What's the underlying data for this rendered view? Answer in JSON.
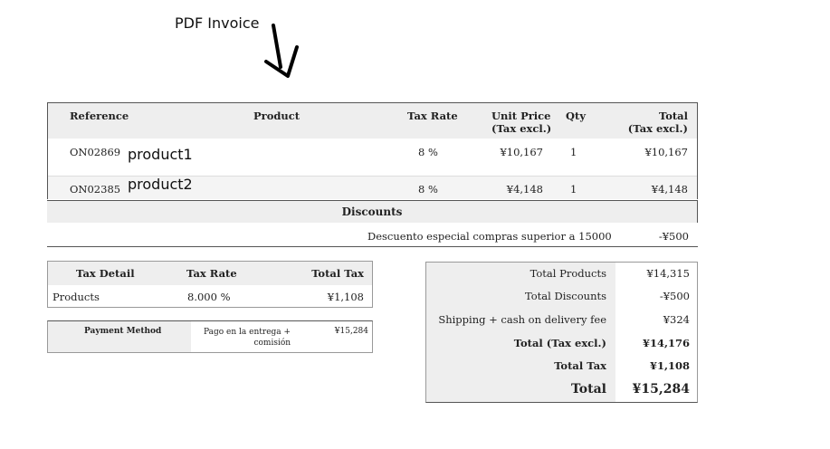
{
  "annotation": {
    "callout": "PDF Invoice"
  },
  "products_table": {
    "headers": {
      "reference": "Reference",
      "product": "Product",
      "tax_rate": "Tax Rate",
      "unit_price_1": "Unit Price",
      "unit_price_2": "(Tax excl.)",
      "qty": "Qty",
      "total_1": "Total",
      "total_2": "(Tax excl.)"
    },
    "rows": [
      {
        "reference": "ON02869",
        "product": "product1",
        "tax_rate": "8 %",
        "unit_price": "¥10,167",
        "qty": "1",
        "total": "¥10,167"
      },
      {
        "reference": "ON02385",
        "product": "product2",
        "tax_rate": "8 %",
        "unit_price": "¥4,148",
        "qty": "1",
        "total": "¥4,148"
      }
    ]
  },
  "discounts": {
    "title": "Discounts",
    "rows": [
      {
        "label": "Descuento especial compras superior a 15000",
        "value": "-¥500"
      }
    ]
  },
  "tax_detail": {
    "headers": {
      "detail": "Tax Detail",
      "rate": "Tax Rate",
      "total": "Total Tax"
    },
    "rows": [
      {
        "detail": "Products",
        "rate": "8.000 %",
        "total": "¥1,108"
      }
    ]
  },
  "payment": {
    "label": "Payment Method",
    "method_line1": "Pago en la entrega +",
    "method_line2": "comisión",
    "amount": "¥15,284"
  },
  "totals": {
    "total_products_label": "Total Products",
    "total_products": "¥14,315",
    "total_discounts_label": "Total Discounts",
    "total_discounts": "-¥500",
    "shipping_label": "Shipping + cash on delivery fee",
    "shipping": "¥324",
    "total_tax_excl_label": "Total (Tax excl.)",
    "total_tax_excl": "¥14,176",
    "total_tax_label": "Total Tax",
    "total_tax": "¥1,108",
    "total_label": "Total",
    "total": "¥15,284"
  }
}
